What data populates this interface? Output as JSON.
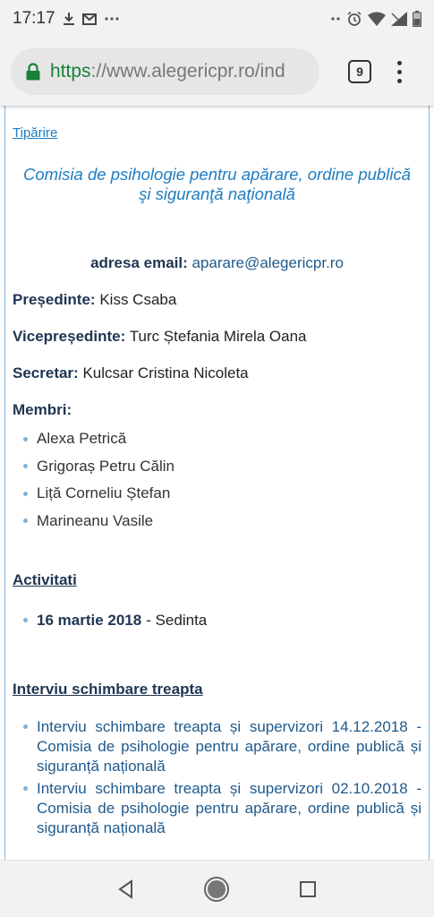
{
  "status_bar": {
    "time": "17:17",
    "left_icons": [
      "download-icon",
      "gmail-icon",
      "more-dots-icon"
    ],
    "right_icons": [
      "nfc-dots-icon",
      "alarm-icon",
      "wifi-icon",
      "signal-icon",
      "battery-icon"
    ]
  },
  "browser": {
    "url_scheme": "https",
    "url_rest": "://www.alegericpr.ro/ind",
    "tab_count": "9"
  },
  "page": {
    "print_link": "Tipărire",
    "committee_title": "Comisia de psihologie pentru apărare, ordine publică şi siguranţă naţională",
    "email_label": "adresa email:",
    "email_value": "aparare@alegericpr.ro",
    "president_label": "Președinte:",
    "president_value": "Kiss Csaba",
    "vice_label": "Vicepreședinte:",
    "vice_value": "Turc Ștefania Mirela Oana",
    "secretary_label": "Secretar:",
    "secretary_value": "Kulcsar Cristina Nicoleta",
    "members_label": "Membri:",
    "members": [
      "Alexa Petrică",
      "Grigoraș Petru Călin",
      "Liță Corneliu Ștefan",
      "Marineanu Vasile"
    ],
    "activities_heading": "Activitati",
    "activity_date": "16 martie 2018",
    "activity_text": "- Sedinta",
    "interview_heading": "Interviu schimbare treapta",
    "interviews": [
      "Interviu schimbare treapta și supervizori 14.12.2018 - Comisia de psihologie pentru apărare, ordine publică și siguranță națională",
      "Interviu schimbare treapta și supervizori 02.10.2018 - Comisia de psihologie pentru apărare, ordine publică și siguranță națională"
    ]
  },
  "nav_bar": {
    "buttons": [
      "back-icon",
      "home-icon",
      "recents-icon"
    ]
  },
  "colors": {
    "link_blue": "#1f7dc1",
    "heading_navy": "#1f3552",
    "https_green": "#188038",
    "border_blue": "#7fb2d8"
  }
}
